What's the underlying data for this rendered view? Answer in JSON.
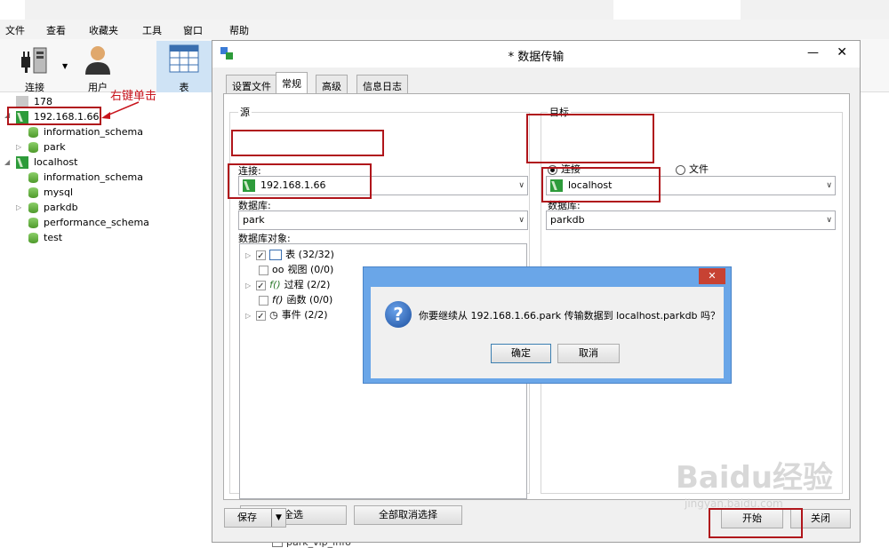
{
  "menu": [
    "文件",
    "查看",
    "收藏夹",
    "工具",
    "窗口",
    "帮助"
  ],
  "toolbar": {
    "connect": "连接",
    "user": "用户",
    "table": "表"
  },
  "annotation": "右键单击",
  "tree": {
    "items": [
      {
        "label": "178",
        "icon": "grey-connection-icon"
      },
      {
        "label": "192.168.1.66",
        "icon": "connection-icon"
      },
      {
        "label": "information_schema",
        "icon": "database-icon"
      },
      {
        "label": "park",
        "icon": "database-icon"
      },
      {
        "label": "localhost",
        "icon": "connection-icon"
      },
      {
        "label": "information_schema",
        "icon": "database-icon"
      },
      {
        "label": "mysql",
        "icon": "database-icon"
      },
      {
        "label": "parkdb",
        "icon": "database-icon"
      },
      {
        "label": "performance_schema",
        "icon": "database-icon"
      },
      {
        "label": "test",
        "icon": "database-icon"
      }
    ],
    "bottom_partial": "park_vip_info"
  },
  "dialog": {
    "title": "* 数据传输",
    "tabs": [
      "设置文件",
      "常规",
      "高级",
      "信息日志"
    ],
    "source": {
      "group_label": "源",
      "connection_label": "连接:",
      "connection_value": "192.168.1.66",
      "database_label": "数据库:",
      "database_value": "park",
      "objects_label": "数据库对象:",
      "objects": [
        {
          "name": "表",
          "count": "(32/32)",
          "checked": true
        },
        {
          "name": "视图",
          "count": "(0/0)",
          "checked": false
        },
        {
          "name": "过程",
          "count": "(2/2)",
          "checked": true
        },
        {
          "name": "函数",
          "count": "(0/0)",
          "checked": false
        },
        {
          "name": "事件",
          "count": "(2/2)",
          "checked": true
        }
      ],
      "select_all": "全选",
      "deselect_all": "全部取消选择"
    },
    "target": {
      "group_label": "目标",
      "radio_connection": "连接",
      "radio_file": "文件",
      "connection_value": "localhost",
      "database_label": "数据库:",
      "database_value": "parkdb"
    },
    "save": "保存",
    "start": "开始",
    "close": "关闭"
  },
  "confirm": {
    "message": "你要继续从 192.168.1.66.park 传输数据到 localhost.parkdb 吗？",
    "ok": "确定",
    "cancel": "取消",
    "close": "✕"
  },
  "watermark": {
    "text": "Baidu经验",
    "sub": "jingyan.baidu.com"
  }
}
